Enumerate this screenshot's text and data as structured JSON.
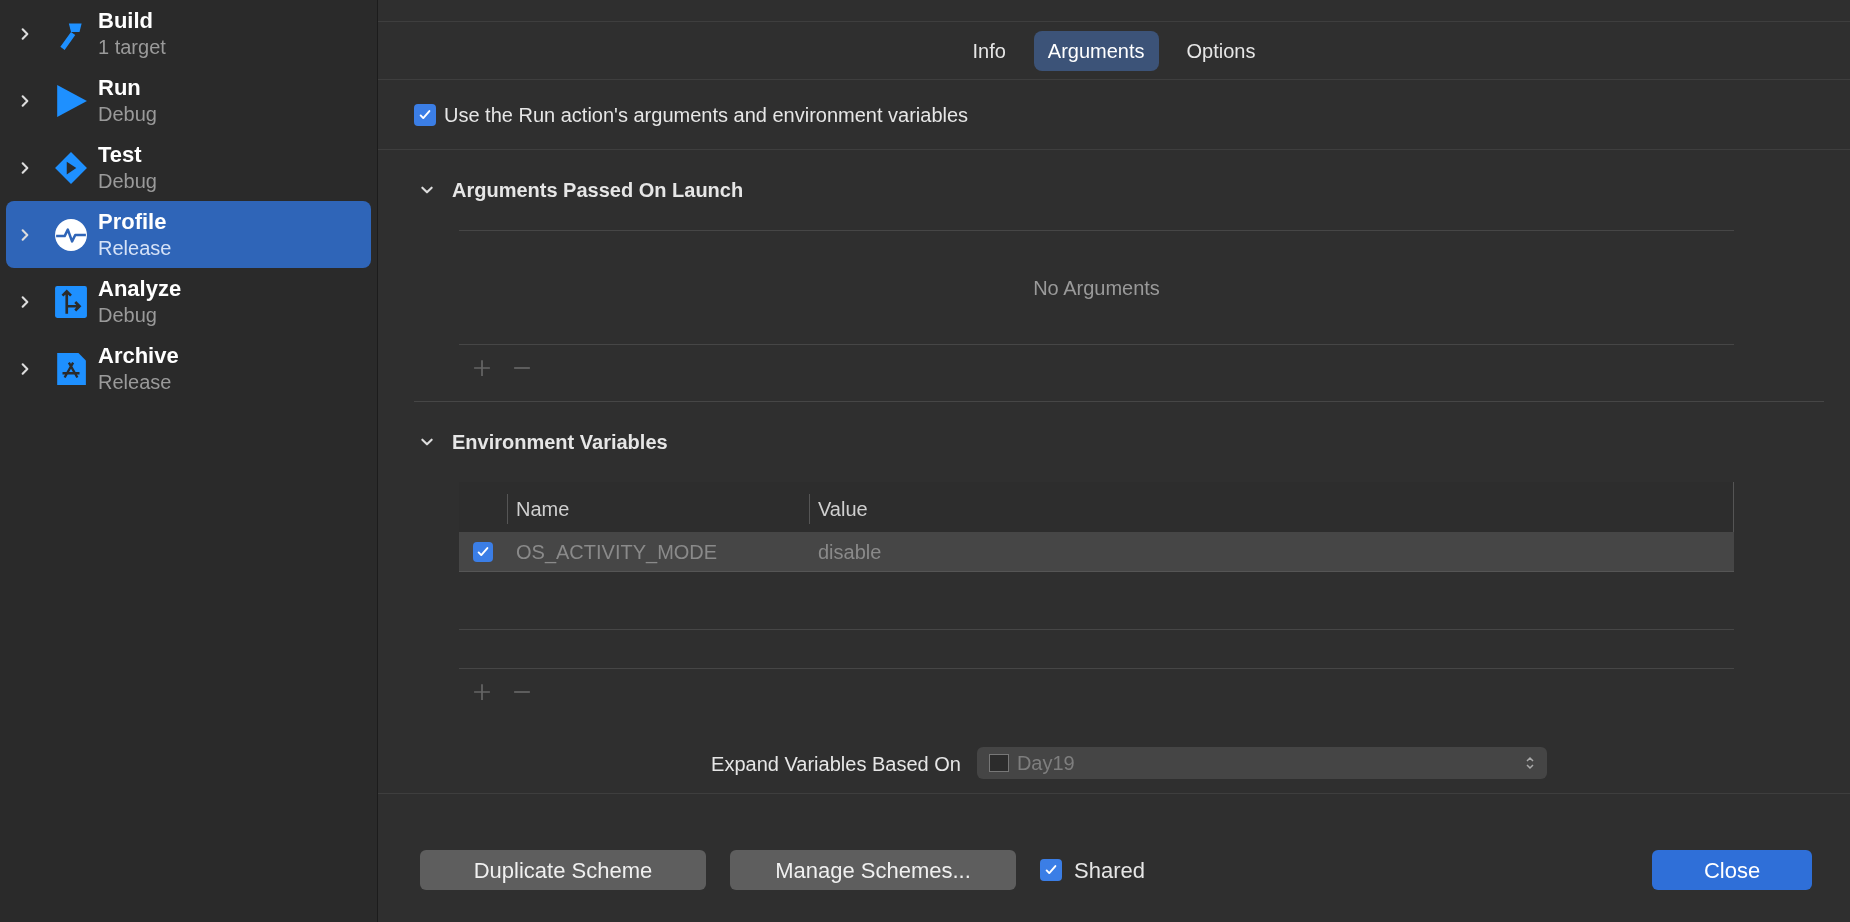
{
  "sidebar": {
    "items": [
      {
        "kind": "build",
        "title": "Build",
        "subtitle": "1 target",
        "selected": false
      },
      {
        "kind": "run",
        "title": "Run",
        "subtitle": "Debug",
        "selected": false
      },
      {
        "kind": "test",
        "title": "Test",
        "subtitle": "Debug",
        "selected": false
      },
      {
        "kind": "profile",
        "title": "Profile",
        "subtitle": "Release",
        "selected": true
      },
      {
        "kind": "analyze",
        "title": "Analyze",
        "subtitle": "Debug",
        "selected": false
      },
      {
        "kind": "archive",
        "title": "Archive",
        "subtitle": "Release",
        "selected": false
      }
    ]
  },
  "tabs": [
    {
      "label": "Info",
      "selected": false
    },
    {
      "label": "Arguments",
      "selected": true
    },
    {
      "label": "Options",
      "selected": false
    }
  ],
  "use_run_action": {
    "label": "Use the Run action's arguments and environment variables",
    "checked": true
  },
  "arguments_section": {
    "title": "Arguments Passed On Launch",
    "expanded": true,
    "empty_text": "No Arguments"
  },
  "environment_section": {
    "title": "Environment Variables",
    "expanded": true,
    "columns": [
      "Name",
      "Value"
    ],
    "rows": [
      {
        "enabled": true,
        "name": "OS_ACTIVITY_MODE",
        "value": "disable",
        "selected": true
      }
    ]
  },
  "expand_variables": {
    "label": "Expand Variables Based On",
    "value": "Day19"
  },
  "footer": {
    "duplicate": "Duplicate Scheme",
    "manage": "Manage Schemes...",
    "shared": {
      "label": "Shared",
      "checked": true
    },
    "close": "Close"
  }
}
